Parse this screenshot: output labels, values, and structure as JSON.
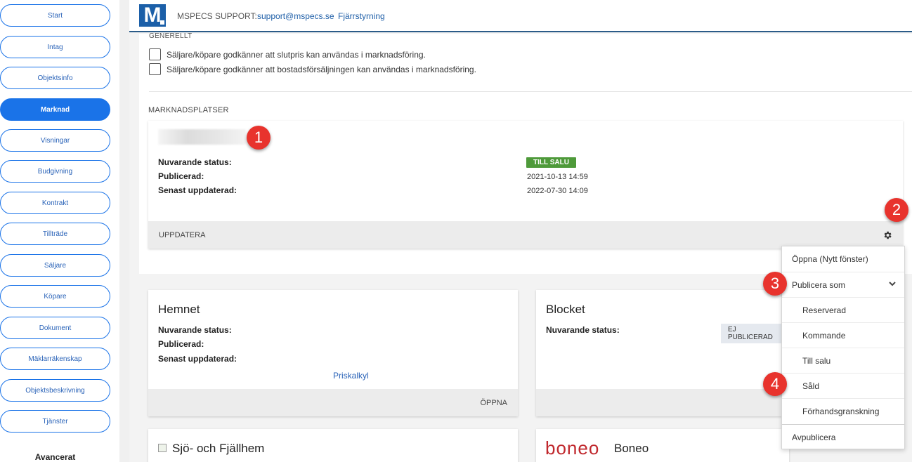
{
  "sidebar": {
    "items": [
      {
        "label": "Start",
        "active": false
      },
      {
        "label": "Intag",
        "active": false
      },
      {
        "label": "Objektsinfo",
        "active": false
      },
      {
        "label": "Marknad",
        "active": true
      },
      {
        "label": "Visningar",
        "active": false
      },
      {
        "label": "Budgivning",
        "active": false
      },
      {
        "label": "Kontrakt",
        "active": false
      },
      {
        "label": "Tillträde",
        "active": false
      },
      {
        "label": "Säljare",
        "active": false
      },
      {
        "label": "Köpare",
        "active": false
      },
      {
        "label": "Dokument",
        "active": false
      },
      {
        "label": "Mäklarräkenskap",
        "active": false
      },
      {
        "label": "Objektsbeskrivning",
        "active": false
      },
      {
        "label": "Tjänster",
        "active": false
      }
    ],
    "advanced_label": "Avancerat"
  },
  "header": {
    "logo_letter": "M",
    "support_label": "MSPECS SUPPORT:",
    "support_email": "support@mspecs.se",
    "remote_link": "Fjärrstyrning"
  },
  "general": {
    "title": "GENERELLT",
    "checkboxes": [
      {
        "label": "Säljare/köpare godkänner att slutpris kan användas i marknadsföring.",
        "checked": false
      },
      {
        "label": "Säljare/köpare godkänner att bostadsförsäljningen kan användas i marknadsföring.",
        "checked": false
      }
    ]
  },
  "marketplaces": {
    "title": "MARKNADSPLATSER",
    "main_card": {
      "status_label": "Nuvarande status:",
      "status_value": "TILL SALU",
      "published_label": "Publicerad:",
      "published_value": "2021-10-13 14:59",
      "updated_label": "Senast uppdaterad:",
      "updated_value": "2022-07-30 14:09",
      "footer_action": "UPPDATERA"
    },
    "hemnet": {
      "title": "Hemnet",
      "status_label": "Nuvarande status:",
      "published_label": "Publicerad:",
      "updated_label": "Senast uppdaterad:",
      "link": "Priskalkyl",
      "footer_action": "ÖPPNA"
    },
    "blocket": {
      "title": "Blocket",
      "status_label": "Nuvarande status:",
      "status_value": "EJ PUBLICERAD"
    },
    "sjo": {
      "title": "Sjö- och Fjällhem"
    },
    "boneo": {
      "logo_text": "boneo",
      "title": "Boneo"
    }
  },
  "dropdown": {
    "open_new": "Öppna  (Nytt fönster)",
    "publish_as": "Publicera som",
    "options": [
      "Reserverad",
      "Kommande",
      "Till salu",
      "Såld",
      "Förhandsgranskning"
    ],
    "unpublish": "Avpublicera"
  },
  "markers": [
    "1",
    "2",
    "3",
    "4"
  ],
  "colors": {
    "accent": "#1a73e8",
    "status_green": "#4e9a3a",
    "marker_red": "#e8332d",
    "boneo_red": "#c0282d",
    "header_border": "#2b5b88"
  }
}
